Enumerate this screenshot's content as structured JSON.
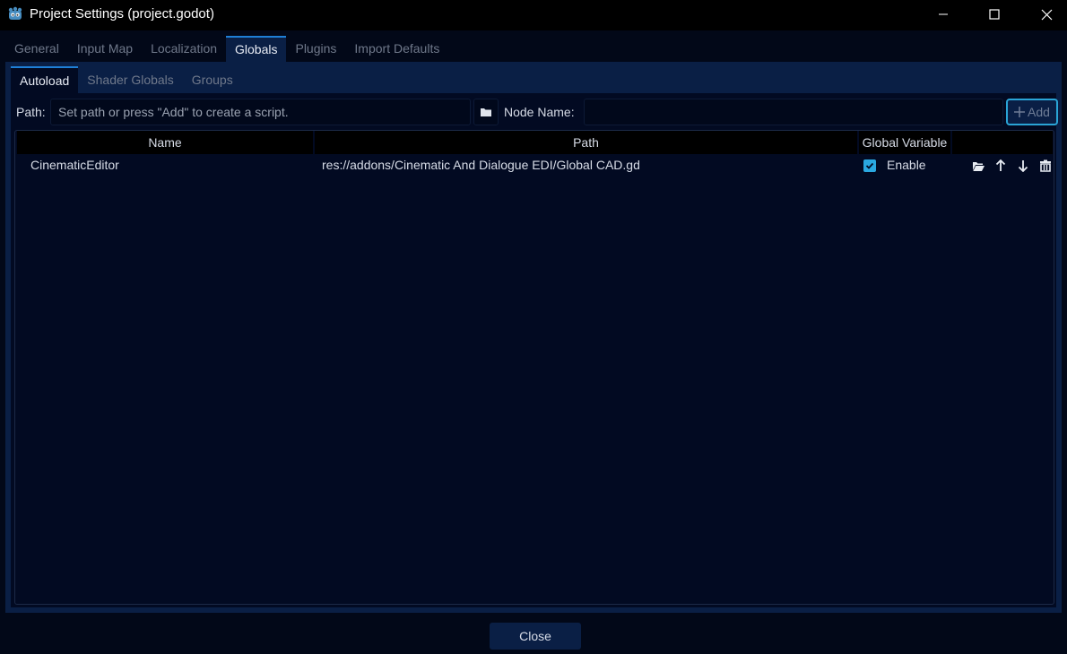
{
  "window": {
    "title": "Project Settings (project.godot)",
    "app_icon": "godot-icon"
  },
  "main_tabs": [
    {
      "label": "General",
      "active": false
    },
    {
      "label": "Input Map",
      "active": false
    },
    {
      "label": "Localization",
      "active": false
    },
    {
      "label": "Globals",
      "active": true
    },
    {
      "label": "Plugins",
      "active": false
    },
    {
      "label": "Import Defaults",
      "active": false
    }
  ],
  "sub_tabs": [
    {
      "label": "Autoload",
      "active": true
    },
    {
      "label": "Shader Globals",
      "active": false
    },
    {
      "label": "Groups",
      "active": false
    }
  ],
  "autoload": {
    "path_label": "Path:",
    "path_placeholder": "Set path or press \"Add\" to create a script.",
    "path_value": "",
    "node_name_label": "Node Name:",
    "node_name_value": "",
    "add_label": "Add"
  },
  "table": {
    "headers": {
      "name": "Name",
      "path": "Path",
      "global": "Global Variable"
    },
    "rows": [
      {
        "name": "CinematicEditor",
        "path": "res://addons/Cinematic And Dialogue EDI/Global CAD.gd",
        "global_checked": true,
        "global_label": "Enable"
      }
    ]
  },
  "footer": {
    "close_label": "Close"
  },
  "colors": {
    "accent": "#1f7fd6",
    "checkbox": "#2aa8e0",
    "background": "#020818",
    "panel": "#0a1f45"
  }
}
